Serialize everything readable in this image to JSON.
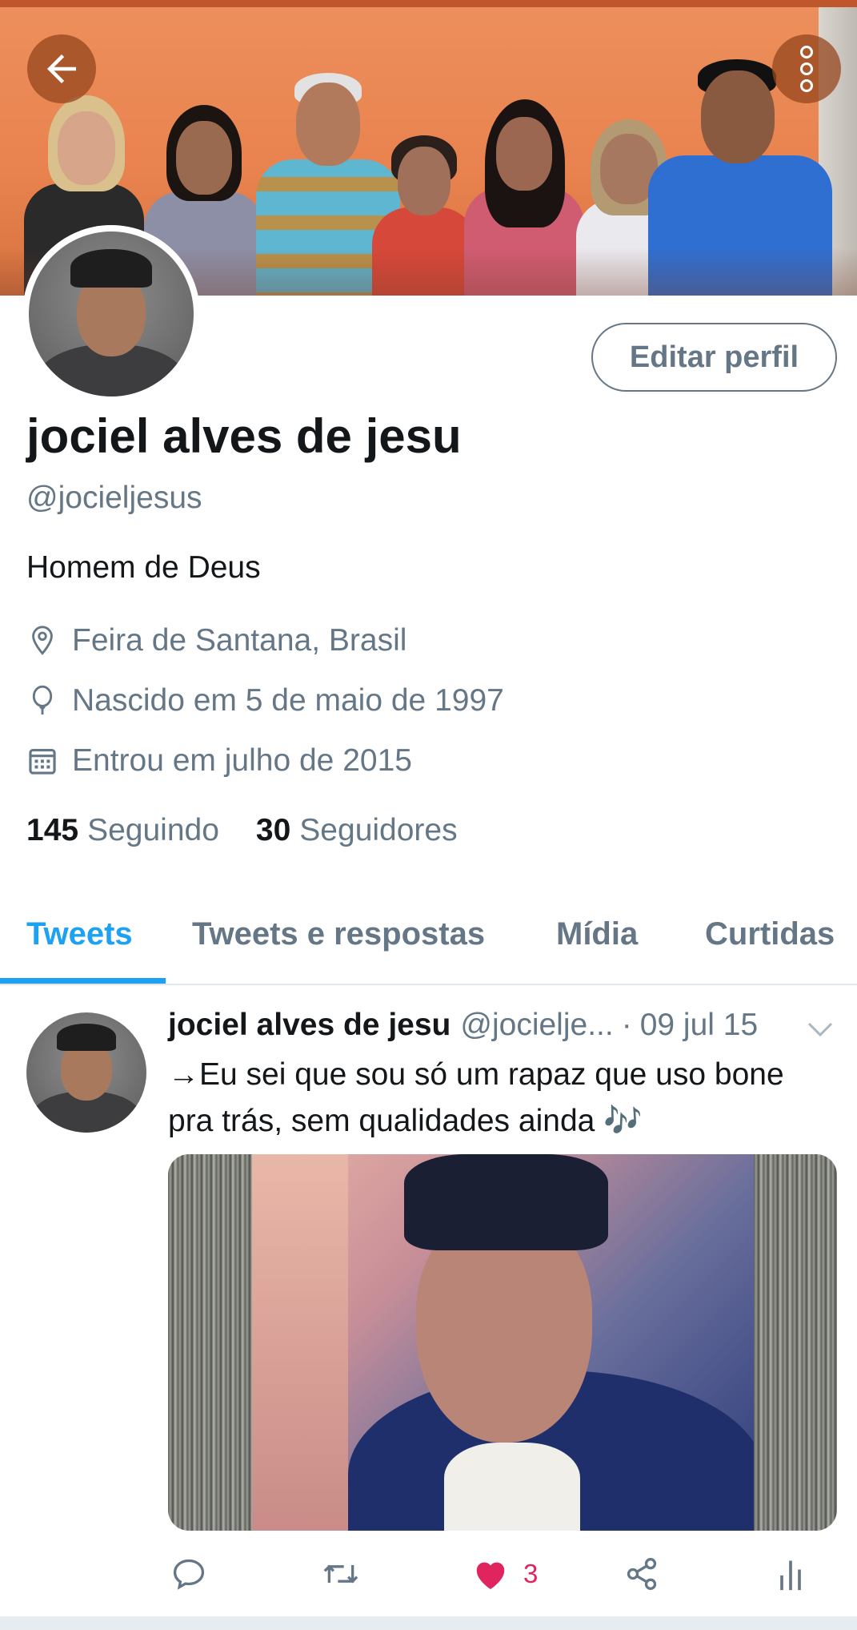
{
  "profile": {
    "display_name": "jociel alves de jesu",
    "handle": "@jocieljesus",
    "bio": "Homem de Deus",
    "location": "Feira de Santana, Brasil",
    "birthday": "Nascido em 5 de maio de 1997",
    "joined": "Entrou em julho de 2015",
    "following_count": "145",
    "following_label": "Seguindo",
    "followers_count": "30",
    "followers_label": "Seguidores",
    "edit_button": "Editar perfil"
  },
  "header": {
    "back_icon": "arrow-left-icon",
    "menu_icon": "more-vertical-icon"
  },
  "tabs": [
    {
      "label": "Tweets",
      "active": true
    },
    {
      "label": "Tweets e respostas",
      "active": false
    },
    {
      "label": "Mídia",
      "active": false
    },
    {
      "label": "Curtidas",
      "active": false
    }
  ],
  "tweet": {
    "author_name": "jociel alves de jesu",
    "author_handle": "@jocielje...",
    "separator": "·",
    "date": "09 jul 15",
    "text": "→Eu sei que sou só um rapaz que uso bone pra trás, sem qualidades ainda 🎶",
    "actions": {
      "reply_icon": "reply-icon",
      "retweet_icon": "retweet-icon",
      "like_icon": "heart-filled-icon",
      "like_count": "3",
      "share_icon": "share-icon",
      "analytics_icon": "analytics-icon"
    }
  },
  "colors": {
    "accent": "#1da1f2",
    "secondary_text": "#657786",
    "like": "#e0245e"
  }
}
